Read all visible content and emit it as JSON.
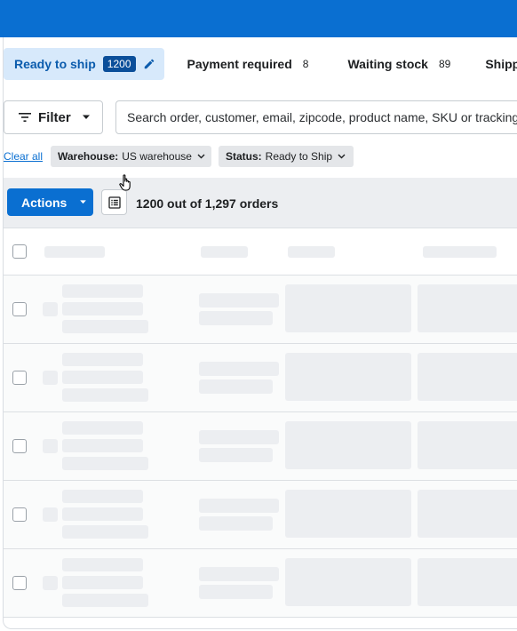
{
  "tabs": [
    {
      "label": "Ready to ship",
      "count": "1200",
      "active": true
    },
    {
      "label": "Payment required",
      "count": "8"
    },
    {
      "label": "Waiting stock",
      "count": "89"
    },
    {
      "label": "Shippe"
    }
  ],
  "filter": {
    "label": "Filter"
  },
  "search": {
    "placeholder": "Search order, customer, email, zipcode, product name, SKU or tracking"
  },
  "chips": {
    "clear_all": "Clear all",
    "warehouse": {
      "key": "Warehouse:",
      "value": "US warehouse"
    },
    "status": {
      "key": "Status:",
      "value": "Ready to Ship"
    }
  },
  "toolbar": {
    "actions_label": "Actions",
    "order_count": "1200 out of 1,297 orders"
  },
  "icons": [
    "pencil-icon",
    "filter-lines-icon",
    "caret-down-icon",
    "chevron-down-icon",
    "list-view-icon",
    "hand-cursor-icon",
    "checkbox"
  ],
  "colors": {
    "brand": "#0a6fd1",
    "active_tab_bg": "#d7e9fb",
    "badge": "#0b4f9a",
    "skeleton": "#eceef1"
  }
}
